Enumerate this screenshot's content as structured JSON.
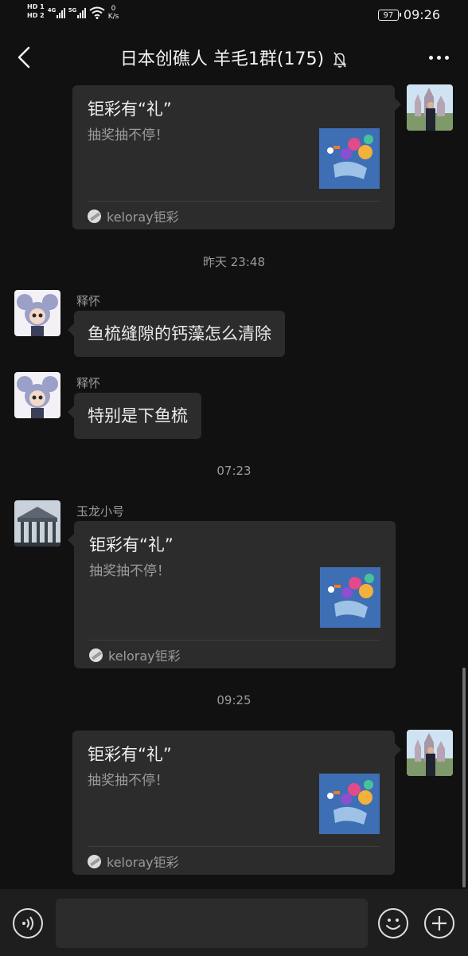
{
  "status_bar": {
    "sim1": "HD 1",
    "sim2": "HD 2",
    "net1": "4G",
    "net2": "5G",
    "speed_value": "0",
    "speed_unit": "K/s",
    "battery": "97",
    "time": "09:26"
  },
  "nav": {
    "title": "日本创礁人 羊毛1群(175)",
    "back_icon": "chevron-left-icon",
    "mute_icon": "bell-off-icon",
    "more_icon": "more-dots-icon"
  },
  "messages": {
    "card1": {
      "title": "钜彩有“礼”",
      "desc": "抽奖抽不停！",
      "source": "keloray钜彩"
    },
    "time1": "昨天 23:48",
    "msg1": {
      "sender": "释怀",
      "text": "鱼梳缝隙的钙藻怎么清除"
    },
    "msg2": {
      "sender": "释怀",
      "text": "特别是下鱼梳"
    },
    "time2": "07:23",
    "card2": {
      "sender": "玉龙小号",
      "title": "钜彩有“礼”",
      "desc": "抽奖抽不停！",
      "source": "keloray钜彩"
    },
    "time3": "09:25",
    "card3": {
      "title": "钜彩有“礼”",
      "desc": "抽奖抽不停！",
      "source": "keloray钜彩"
    }
  },
  "input_bar": {
    "voice_icon": "voice-icon",
    "emoji_icon": "emoji-icon",
    "plus_icon": "plus-icon",
    "text_value": ""
  },
  "colors": {
    "background": "#111111",
    "bubble": "#2c2c2c",
    "secondary_text": "#9b9b9b"
  }
}
